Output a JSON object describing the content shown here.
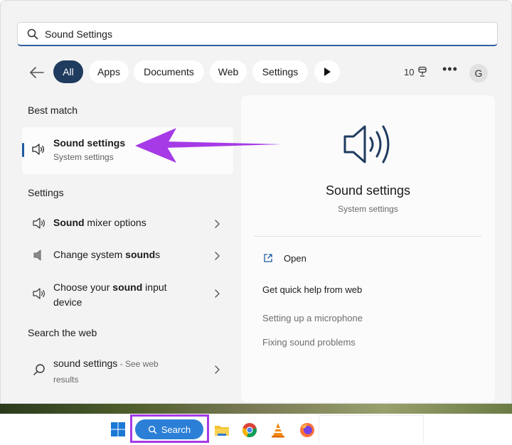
{
  "search": {
    "value": "Sound Settings"
  },
  "filters": {
    "chips": [
      {
        "label": "All",
        "active": true
      },
      {
        "label": "Apps"
      },
      {
        "label": "Documents"
      },
      {
        "label": "Web"
      },
      {
        "label": "Settings"
      }
    ],
    "count": "10"
  },
  "profile": {
    "initial": "G"
  },
  "best_match": {
    "heading": "Best match",
    "title": "Sound settings",
    "subtitle": "System settings"
  },
  "settings_section": {
    "heading": "Settings",
    "items": [
      {
        "label_pre": "",
        "label_bold": "Sound",
        "label_post": " mixer options"
      },
      {
        "label_pre": "Change system ",
        "label_bold": "sound",
        "label_post": "s"
      },
      {
        "label_pre": "Choose your ",
        "label_bold": "sound",
        "label_post": " input",
        "line2": "device"
      }
    ]
  },
  "web_section": {
    "heading": "Search the web",
    "item": {
      "label": "sound settings",
      "suffix": " - See web",
      "line2": "results"
    }
  },
  "preview": {
    "title": "Sound settings",
    "subtitle": "System settings",
    "open_label": "Open",
    "help_heading": "Get quick help from web",
    "links": [
      "Setting up a microphone",
      "Fixing sound problems"
    ]
  },
  "taskbar": {
    "search_label": "Search"
  },
  "colors": {
    "accent": "#1f3b5e",
    "annotation": "#a53ae6",
    "taskbar_search": "#2c7fd6"
  },
  "icons": {
    "search": "search-icon",
    "back": "back-arrow-icon",
    "speaker": "speaker-icon",
    "chevron": "chevron-right-icon",
    "open": "open-external-icon",
    "windows": "windows-logo-icon"
  }
}
